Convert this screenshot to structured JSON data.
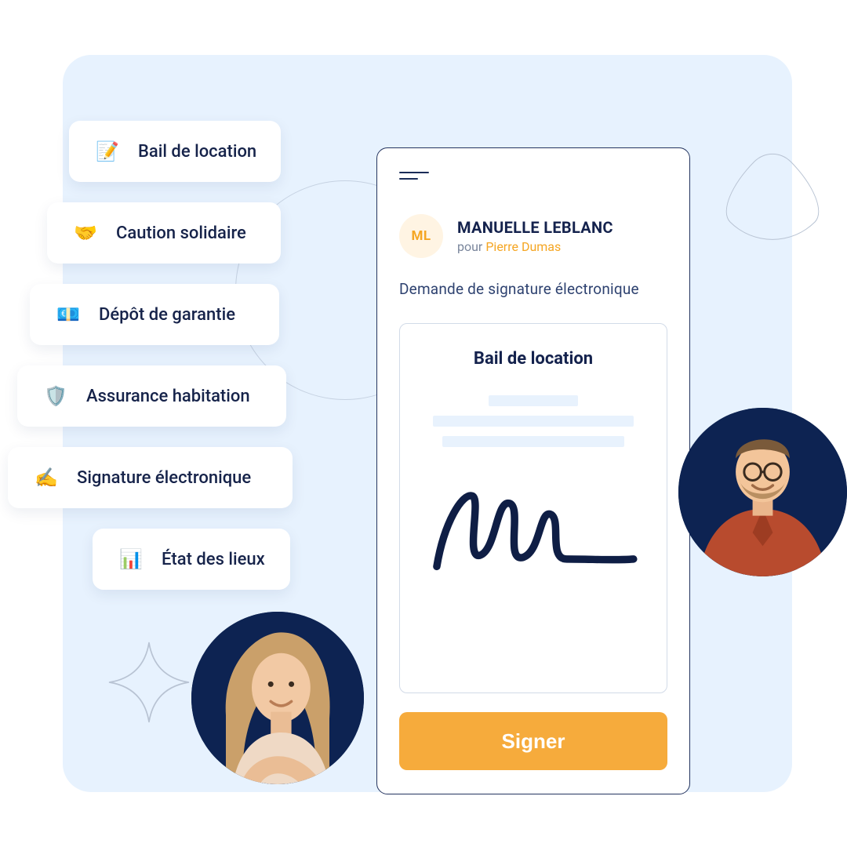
{
  "features": [
    {
      "icon": "📝",
      "label": "Bail de location"
    },
    {
      "icon": "🤝",
      "label": "Caution solidaire"
    },
    {
      "icon": "💶",
      "label": "Dépôt de garantie"
    },
    {
      "icon": "🛡️",
      "label": "Assurance habitation"
    },
    {
      "icon": "✍️",
      "label": "Signature électronique"
    },
    {
      "icon": "📊",
      "label": "État des lieux"
    }
  ],
  "phone": {
    "avatar_initials": "ML",
    "user_name": "MANUELLE LEBLANC",
    "user_sub_prefix": "pour ",
    "user_sub_name": "Pierre Dumas",
    "request_label": "Demande de signature électronique",
    "doc_title": "Bail de location",
    "sign_button": "Signer"
  },
  "colors": {
    "panel_bg": "#e7f2fe",
    "accent": "#f6ab3c",
    "navy": "#14224d"
  }
}
